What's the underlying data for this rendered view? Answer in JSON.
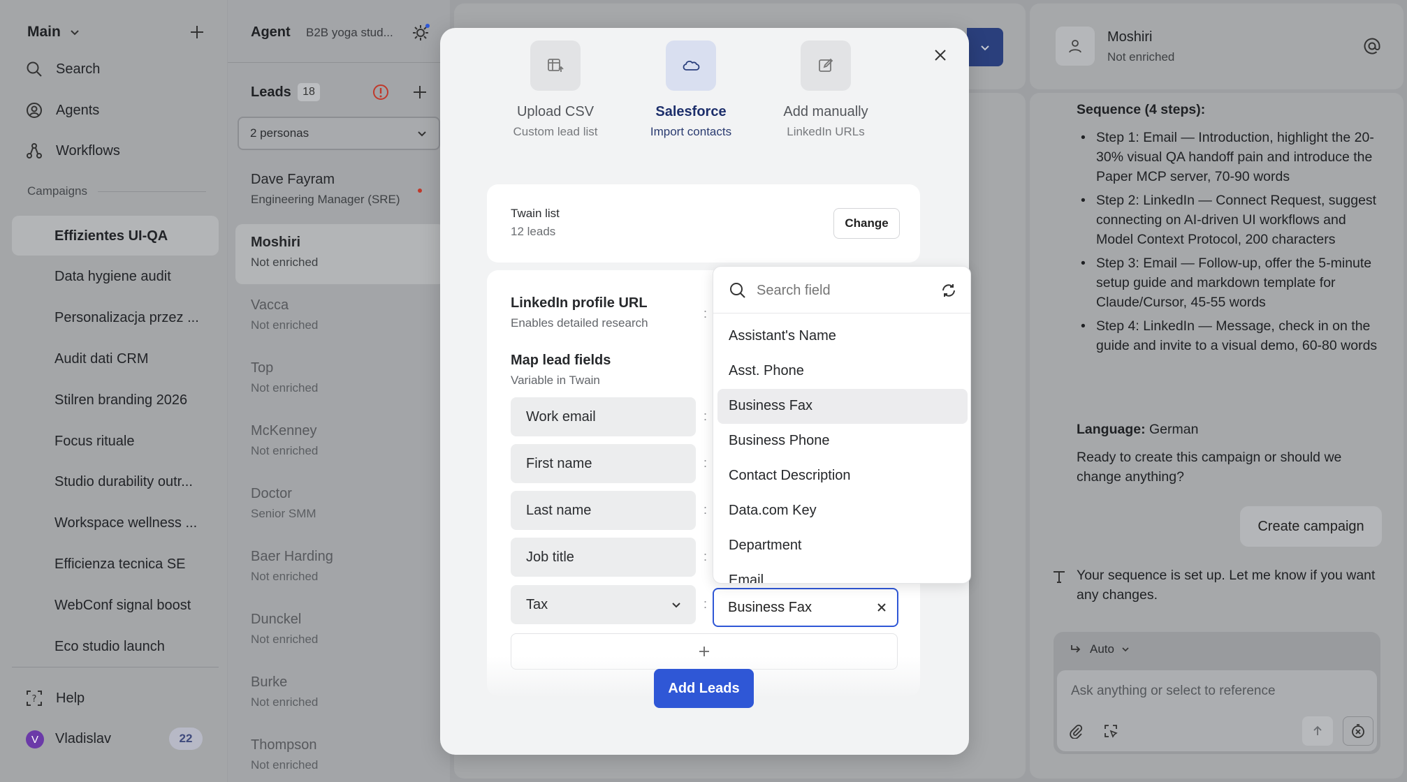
{
  "sidebar": {
    "workspace": "Main",
    "nav": [
      {
        "label": "Search",
        "icon": "search-icon"
      },
      {
        "label": "Agents",
        "icon": "agents-icon"
      },
      {
        "label": "Workflows",
        "icon": "workflows-icon"
      }
    ],
    "section_label": "Campaigns",
    "campaigns": [
      "Effizientes UI-QA",
      "Data hygiene audit",
      "Personalizacja przez ...",
      "Audit dati CRM",
      "Stilren branding 2026",
      "Focus rituale",
      "Studio durability outr...",
      "Workspace wellness ...",
      "Efficienza tecnica SE",
      "WebConf signal boost",
      "Eco studio launch"
    ],
    "help_label": "Help",
    "user_initial": "V",
    "user_name": "Vladislav",
    "user_badge": "22"
  },
  "leads_panel": {
    "agent_label": "Agent",
    "agent_name": "B2B yoga stud...",
    "leads_title": "Leads",
    "leads_count": "18",
    "persona_select": "2 personas",
    "leads": [
      {
        "name": "Dave Fayram",
        "sub": "Engineering Manager (SRE)"
      },
      {
        "name": "Moshiri",
        "sub": "Not enriched"
      },
      {
        "name": "Vacca",
        "sub": "Not enriched"
      },
      {
        "name": "Top",
        "sub": "Not enriched"
      },
      {
        "name": "McKenney",
        "sub": "Not enriched"
      },
      {
        "name": "Doctor",
        "sub": "Senior SMM"
      },
      {
        "name": "Baer Harding",
        "sub": "Not enriched"
      },
      {
        "name": "Dunckel",
        "sub": "Not enriched"
      },
      {
        "name": "Burke",
        "sub": "Not enriched"
      },
      {
        "name": "Thompson",
        "sub": "Not enriched"
      }
    ]
  },
  "right_panel": {
    "contact_name": "Moshiri",
    "contact_status": "Not enriched",
    "sequence_title": "Sequence (4 steps):",
    "steps": [
      "Step 1: Email — Introduction, highlight the 20-30% visual QA handoff pain and introduce the Paper MCP server, 70-90 words",
      "Step 2: LinkedIn — Connect Request, suggest connecting on AI-driven UI workflows and Model Context Protocol, 200 characters",
      "Step 3: Email — Follow-up, offer the 5-minute setup guide and markdown template for Claude/Cursor, 45-55 words",
      "Step 4: LinkedIn — Message, check in on the guide and invite to a visual demo, 60-80 words"
    ],
    "language_label": "Language:",
    "language_value": "German",
    "question": "Ready to create this campaign or should we change anything?",
    "create_button": "Create campaign",
    "assistant_reply": "Your sequence is set up. Let me know if you want any changes.",
    "mode_label": "Auto",
    "composer_placeholder": "Ask anything or select to reference"
  },
  "modal": {
    "sources": [
      {
        "title": "Upload CSV",
        "sub": "Custom lead list",
        "active": false
      },
      {
        "title": "Salesforce",
        "sub": "Import contacts",
        "active": true
      },
      {
        "title": "Add manually",
        "sub": "LinkedIn URLs",
        "active": false
      }
    ],
    "list_title": "Twain list",
    "list_count": "12 leads",
    "change_button": "Change",
    "linkedin_title": "LinkedIn profile URL",
    "linkedin_sub": "Enables detailed research",
    "map_title": "Map lead fields",
    "map_sub": "Variable in Twain",
    "fields": [
      "Work email",
      "First name",
      "Last name",
      "Job title"
    ],
    "custom_field": "Tax",
    "selected_mapping": "Business Fax",
    "add_button": "Add Leads",
    "dropdown": {
      "placeholder": "Search field",
      "options": [
        "Assistant's Name",
        "Asst. Phone",
        "Business Fax",
        "Business Phone",
        "Contact Description",
        "Data.com Key",
        "Department",
        "Email"
      ],
      "highlighted": "Business Fax"
    }
  },
  "colors": {
    "accent": "#2f57d6",
    "salesforce_active": "#1d2f6b",
    "alert": "#c0392b"
  }
}
